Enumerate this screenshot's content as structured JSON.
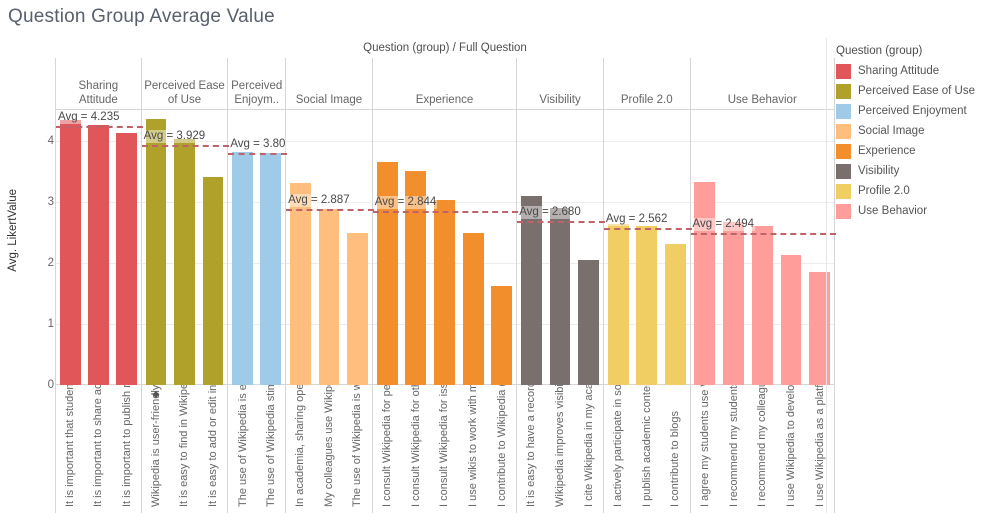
{
  "title": "Question Group Average Value",
  "column_header_title": "Question (group)  /  Full Question",
  "y_axis_title": "Avg. LikertValue",
  "legend": {
    "title": "Question (group)",
    "items": [
      {
        "label": "Sharing Attitude",
        "color": "#e15759"
      },
      {
        "label": "Perceived Ease of Use",
        "color": "#b0a12a"
      },
      {
        "label": "Perceived Enjoyment",
        "color": "#a0cbe8"
      },
      {
        "label": "Social Image",
        "color": "#ffbe7d"
      },
      {
        "label": "Experience",
        "color": "#f28e2b"
      },
      {
        "label": "Visibility",
        "color": "#79706e"
      },
      {
        "label": "Profile 2.0",
        "color": "#f1ce63"
      },
      {
        "label": "Use Behavior",
        "color": "#ff9d9a"
      }
    ]
  },
  "chart_data": {
    "type": "bar",
    "title": "Question Group Average Value",
    "xlabel": "Question (group)  /  Full Question",
    "ylabel": "Avg. LikertValue",
    "ylim": [
      0,
      4.5
    ],
    "yticks": [
      "0",
      "1",
      "2",
      "3",
      "4"
    ],
    "grid": true,
    "legend_position": "right",
    "reference_line_label_prefix": "Avg = ",
    "groups": [
      {
        "group": "Sharing Attitude",
        "header_label": "Sharing Attitude",
        "color": "#e15759",
        "average": 4.235,
        "average_label": "Avg = 4.235",
        "bars": [
          {
            "label": "It is important that studen..",
            "value": 4.33
          },
          {
            "label": "It is important to share ac..",
            "value": 4.25
          },
          {
            "label": "It is important to publish r..",
            "value": 4.13
          }
        ]
      },
      {
        "group": "Perceived Ease of Use",
        "header_label": "Perceived Ease of Use",
        "color": "#b0a12a",
        "average": 3.929,
        "average_label": "Avg = 3.929",
        "bars": [
          {
            "label": "Wikipedia is user-friendly..",
            "value": 4.35,
            "marker": "diamond"
          },
          {
            "label": "It is easy to find in Wikipe..",
            "value": 4.02
          },
          {
            "label": "It is easy to add or edit inf..",
            "value": 3.4
          }
        ]
      },
      {
        "group": "Perceived Enjoyment",
        "header_label": "Perceived Enjoym..",
        "color": "#a0cbe8",
        "average": 3.8,
        "average_label": "Avg = 3.80",
        "bars": [
          {
            "label": "The use of Wikipedia is ent..",
            "value": 3.81
          },
          {
            "label": "The use of Wikipedia stim..",
            "value": 3.8
          }
        ]
      },
      {
        "group": "Social Image",
        "header_label": "Social Image",
        "color": "#ffbe7d",
        "average": 2.887,
        "average_label": "Avg = 2.887",
        "bars": [
          {
            "label": "In academia, sharing open ..",
            "value": 3.3
          },
          {
            "label": "My colleagues use Wikipe..",
            "value": 2.88
          },
          {
            "label": "The use of Wikipedia is we..",
            "value": 2.49
          }
        ]
      },
      {
        "group": "Experience",
        "header_label": "Experience",
        "color": "#f28e2b",
        "average": 2.844,
        "average_label": "Avg = 2.844",
        "bars": [
          {
            "label": "I consult Wikipedia for per..",
            "value": 3.65
          },
          {
            "label": "I consult Wikipedia for oth..",
            "value": 3.51
          },
          {
            "label": "I consult Wikipedia for iss..",
            "value": 3.02
          },
          {
            "label": "I use wikis to work with m..",
            "value": 2.49
          },
          {
            "label": "I contribute to Wikipedia (..",
            "value": 1.62
          }
        ]
      },
      {
        "group": "Visibility",
        "header_label": "Visibility",
        "color": "#79706e",
        "average": 2.68,
        "average_label": "Avg = 2.680",
        "bars": [
          {
            "label": "It is easy to have a record ..",
            "value": 3.1
          },
          {
            "label": "Wikipedia improves visibil..",
            "value": 2.89
          },
          {
            "label": "I cite Wikipedia in my acad..",
            "value": 2.04
          }
        ]
      },
      {
        "group": "Profile 2.0",
        "header_label": "Profile 2.0",
        "color": "#f1ce63",
        "average": 2.562,
        "average_label": "Avg = 2.562",
        "bars": [
          {
            "label": "I actively participate in so..",
            "value": 2.64
          },
          {
            "label": "I publish academic content..",
            "value": 2.61
          },
          {
            "label": "I contribute to blogs",
            "value": 2.3
          }
        ]
      },
      {
        "group": "Use Behavior",
        "header_label": "Use Behavior",
        "color": "#ff9d9a",
        "average": 2.494,
        "average_label": "Avg = 2.494",
        "bars": [
          {
            "label": "I agree my students use W..",
            "value": 3.32
          },
          {
            "label": "I recommend my students ..",
            "value": 2.66
          },
          {
            "label": "I recommend my colleague..",
            "value": 2.61
          },
          {
            "label": "I use Wikipedia to develop ..",
            "value": 2.13
          },
          {
            "label": "I use Wikipedia as a platfo..",
            "value": 1.85
          }
        ]
      }
    ]
  }
}
